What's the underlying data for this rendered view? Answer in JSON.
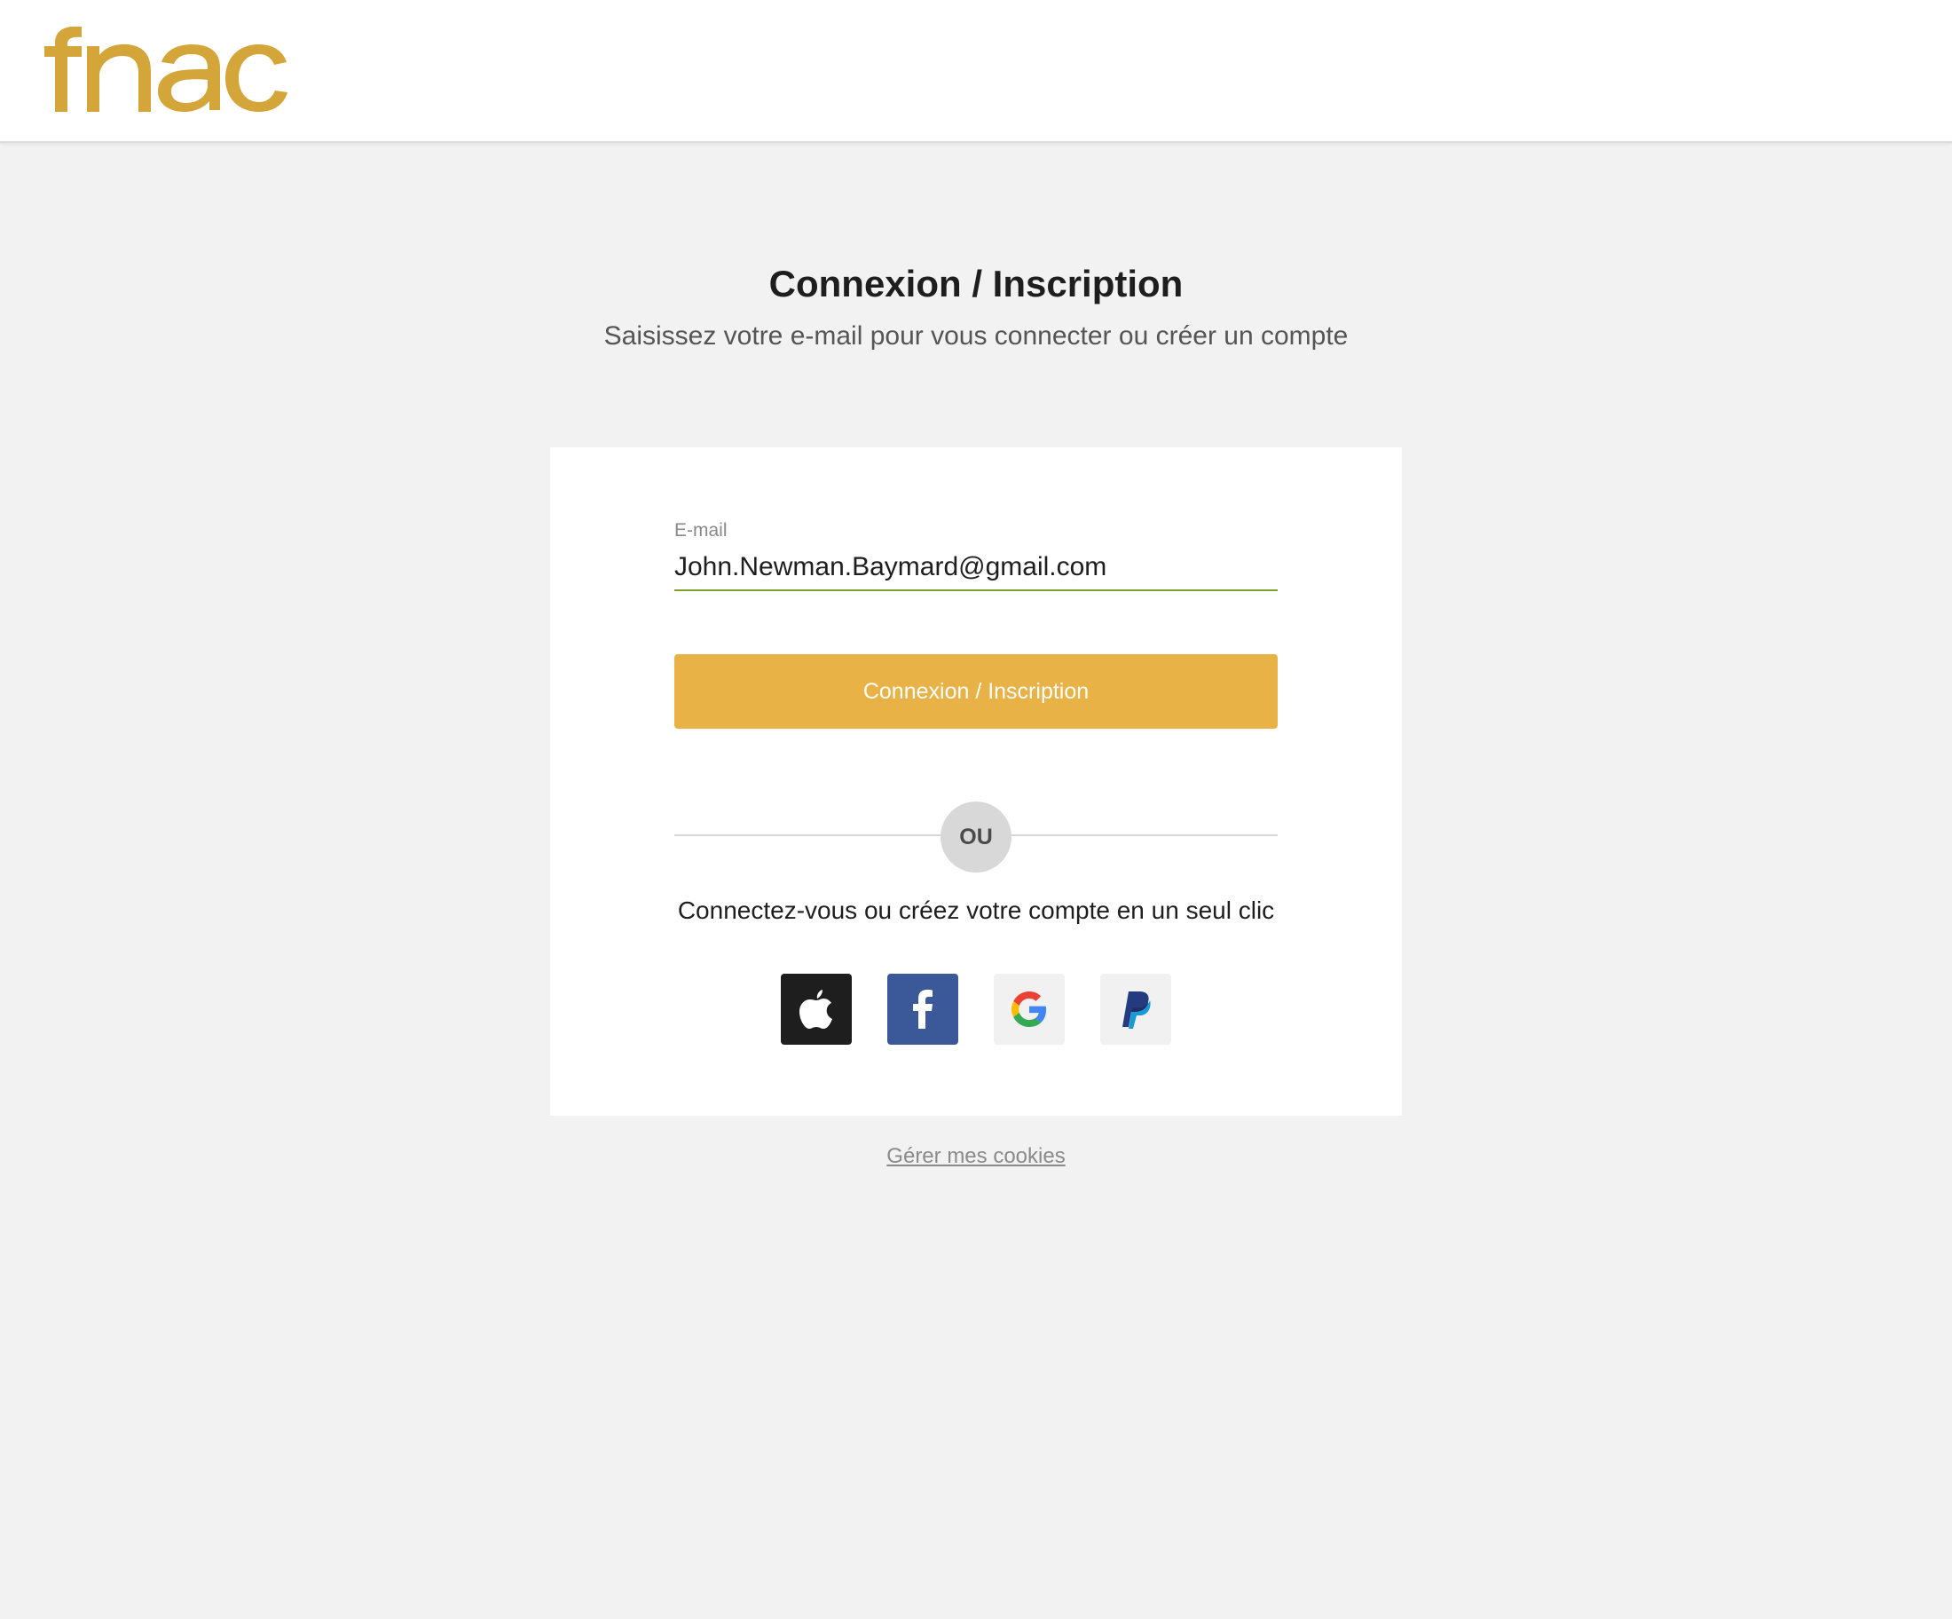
{
  "header": {
    "logo_text": "fnac",
    "logo_color": "#d4a63a"
  },
  "main": {
    "title": "Connexion / Inscription",
    "subtitle": "Saisissez votre e-mail pour vous connecter ou créer un compte"
  },
  "form": {
    "email_label": "E-mail",
    "email_value": "John.Newman.Baymard@gmail.com",
    "submit_label": "Connexion / Inscription",
    "submit_color": "#e9b246",
    "divider_label": "OU",
    "social_text": "Connectez-vous ou créez votre compte en un seul clic",
    "social_buttons": [
      {
        "provider": "Apple",
        "icon": "apple-icon"
      },
      {
        "provider": "Facebook",
        "icon": "facebook-icon"
      },
      {
        "provider": "Google",
        "icon": "google-icon"
      },
      {
        "provider": "PayPal",
        "icon": "paypal-icon"
      }
    ]
  },
  "footer": {
    "cookies_label": "Gérer mes cookies"
  }
}
